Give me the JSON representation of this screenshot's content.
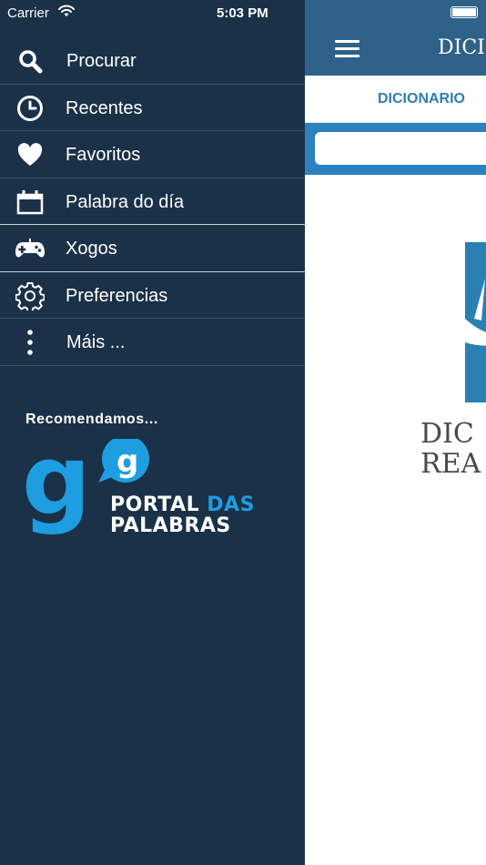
{
  "status_bar": {
    "carrier": "Carrier",
    "time": "5:03 PM"
  },
  "sidebar": {
    "items": [
      {
        "label": "Procurar",
        "icon": "search-icon"
      },
      {
        "label": "Recentes",
        "icon": "clock-icon"
      },
      {
        "label": "Favoritos",
        "icon": "heart-icon"
      },
      {
        "label": "Palabra do día",
        "icon": "calendar-icon"
      },
      {
        "label": "Xogos",
        "icon": "gamepad-icon"
      },
      {
        "label": "Preferencias",
        "icon": "gear-icon"
      },
      {
        "label": "Máis ...",
        "icon": "more-vertical-icon"
      }
    ],
    "recommend_heading": "Recomendamos...",
    "portal": {
      "mark_big": "g",
      "mark_small": "g",
      "line1": "PORTAL",
      "line1_accent": "DAS",
      "line2": "PALABRAS"
    }
  },
  "main": {
    "title": "DICI",
    "tab_label": "DICIONARIO",
    "search_value": "",
    "logo_text_line1": "DIC",
    "logo_text_line2": "REA"
  },
  "colors": {
    "sidebar_bg": "#1b3148",
    "header_bg": "#2e6288",
    "search_bar_bg": "#2c82c0",
    "tab_text": "#2a7fb3",
    "portal_blue": "#1e9de0"
  }
}
